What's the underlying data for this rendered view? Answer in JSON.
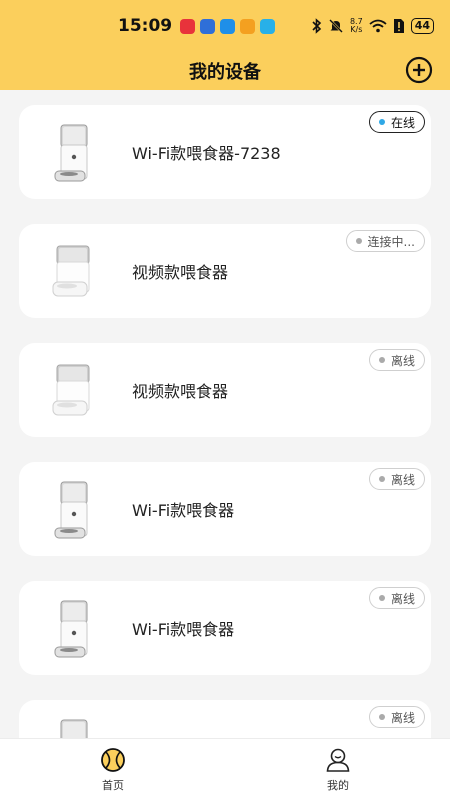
{
  "status_bar": {
    "time": "15:09",
    "net_speed_value": "8.7",
    "net_speed_unit": "K/s",
    "battery": "44",
    "app_icon_colors": [
      "#e8333b",
      "#2f6fd8",
      "#1f8fe8",
      "#f4a020",
      "#28b0e8"
    ]
  },
  "header": {
    "title": "我的设备",
    "add_icon": "plus-circle-icon"
  },
  "devices": [
    {
      "name": "Wi-Fi款喂食器-7238",
      "status": "在线",
      "model": "wifi"
    },
    {
      "name": "视频款喂食器",
      "status": "连接中...",
      "model": "video"
    },
    {
      "name": "视频款喂食器",
      "status": "离线",
      "model": "video"
    },
    {
      "name": "Wi-Fi款喂食器",
      "status": "离线",
      "model": "wifi"
    },
    {
      "name": "Wi-Fi款喂食器",
      "status": "离线",
      "model": "wifi"
    },
    {
      "name": "",
      "status": "离线",
      "model": "wifi"
    }
  ],
  "tabs": [
    {
      "label": "首页",
      "icon": "home-ball-icon",
      "active": true
    },
    {
      "label": "我的",
      "icon": "profile-icon",
      "active": false
    }
  ],
  "colors": {
    "header_bg": "#fbcf5c",
    "online_dot": "#2fa8e6",
    "offline_dot": "#aaaaaa"
  }
}
